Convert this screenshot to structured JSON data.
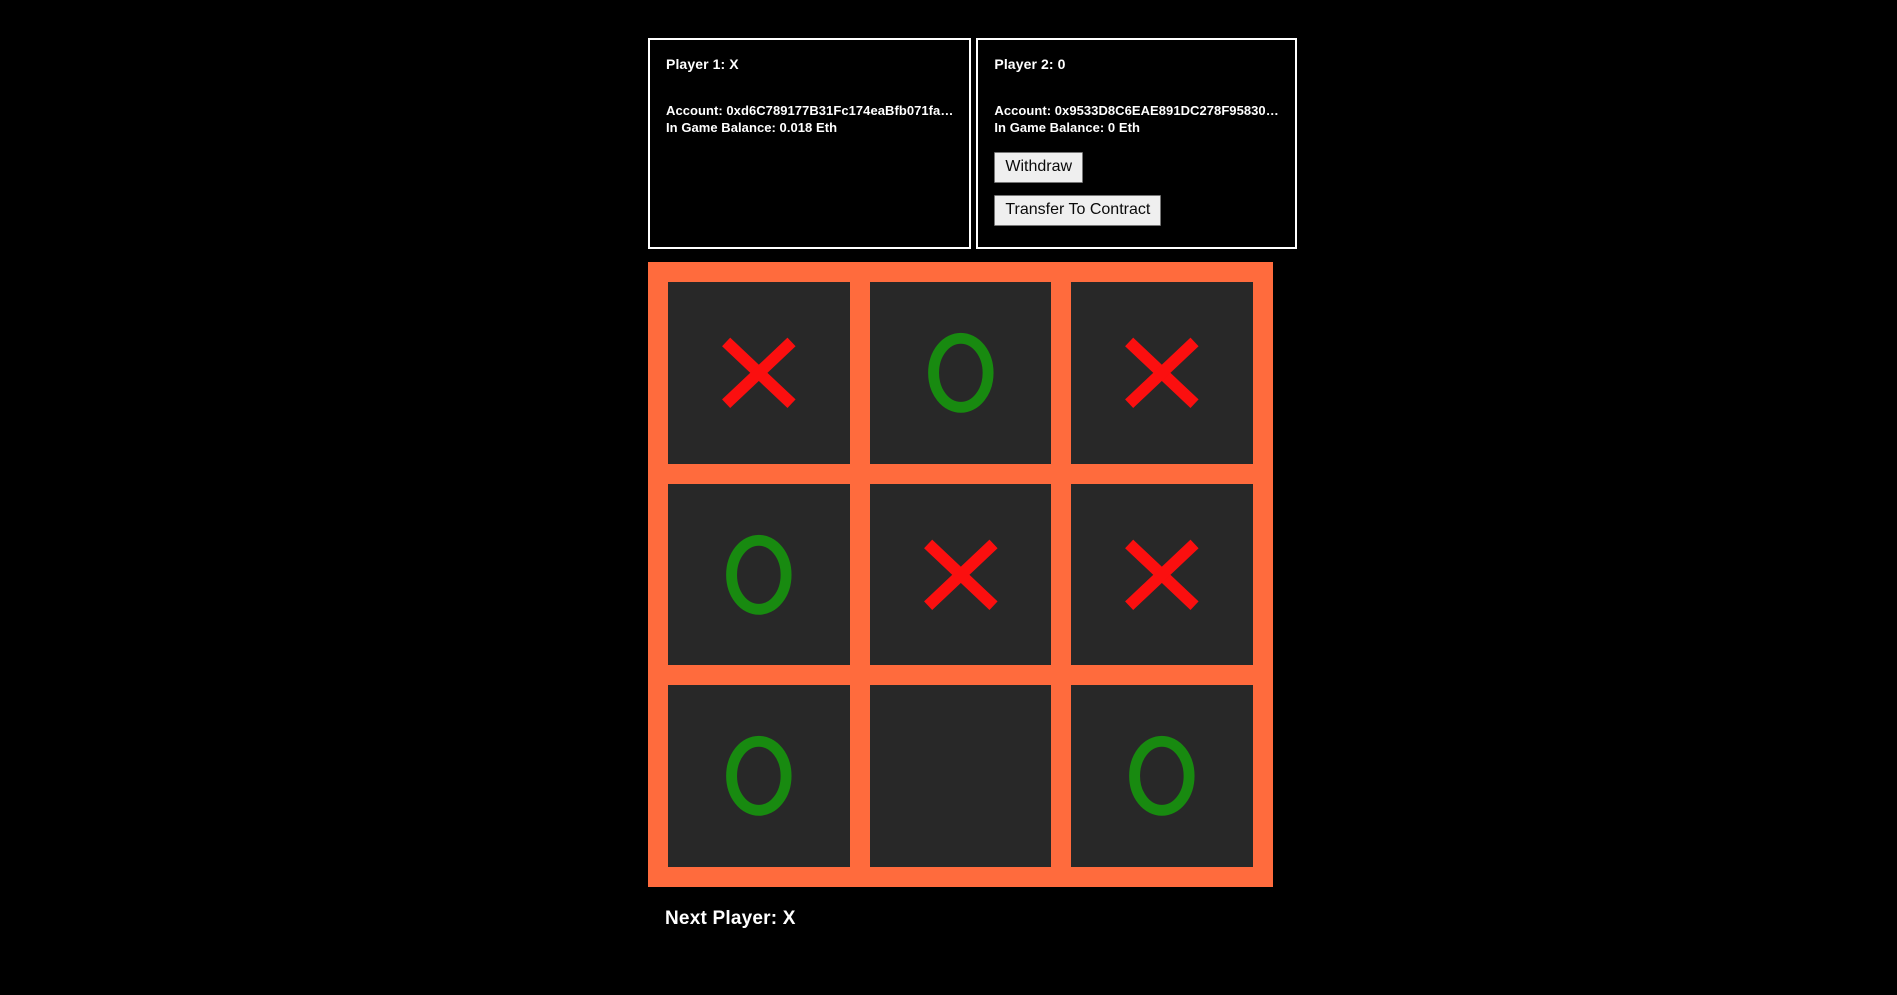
{
  "theme": {
    "background": "#000000",
    "board_bg": "#ff6b3d",
    "cell_bg": "#282828",
    "x_color": "#fb0f0f",
    "o_color": "#188a10",
    "text_color": "#ffffff",
    "button_bg": "#efefef",
    "button_text": "#0a0a0a",
    "panel_border": "#ffffff"
  },
  "players": [
    {
      "title": "Player 1: X",
      "account_label": "Account: 0xd6C789177B31Fc174eaBfb071fa…",
      "balance_label": "In Game Balance: 0.018 Eth",
      "buttons": []
    },
    {
      "title": "Player 2: 0",
      "account_label": "Account: 0x9533D8C6EAE891DC278F95830…",
      "balance_label": "In Game Balance: 0 Eth",
      "buttons": [
        {
          "label": "Withdraw",
          "name": "withdraw-button"
        },
        {
          "label": "Transfer To Contract",
          "name": "transfer-to-contract-button"
        }
      ]
    }
  ],
  "board": {
    "cells": [
      {
        "index": 0,
        "mark": "X"
      },
      {
        "index": 1,
        "mark": "O"
      },
      {
        "index": 2,
        "mark": "X"
      },
      {
        "index": 3,
        "mark": "O"
      },
      {
        "index": 4,
        "mark": "X"
      },
      {
        "index": 5,
        "mark": "X"
      },
      {
        "index": 6,
        "mark": "O"
      },
      {
        "index": 7,
        "mark": ""
      },
      {
        "index": 8,
        "mark": "O"
      }
    ]
  },
  "status": {
    "text": "Next Player: X"
  }
}
